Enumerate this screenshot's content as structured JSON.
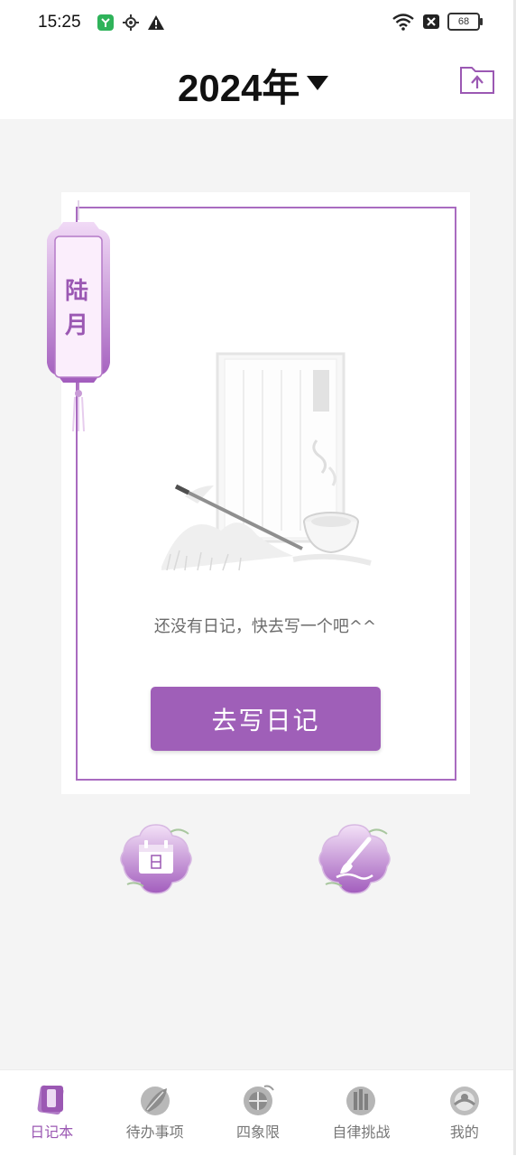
{
  "status_bar": {
    "time": "15:25",
    "battery": "68",
    "icons": [
      "app-notification-icon",
      "location-icon",
      "warning-icon",
      "wifi-icon",
      "no-sim-icon",
      "battery-icon"
    ]
  },
  "header": {
    "year_label": "2024年",
    "upload_icon": "cloud-upload-icon"
  },
  "diary_card": {
    "month_label": "陆\n月",
    "empty_message": "还没有日记，快去写一个吧^^",
    "write_button": "去写日记"
  },
  "quick_actions": [
    {
      "icon": "calendar-icon"
    },
    {
      "icon": "brush-icon"
    }
  ],
  "tabbar": {
    "active": 0,
    "tabs": [
      {
        "label": "日记本",
        "icon": "diary-book-icon"
      },
      {
        "label": "待办事项",
        "icon": "todo-leaf-icon"
      },
      {
        "label": "四象限",
        "icon": "quadrant-icon"
      },
      {
        "label": "自律挑战",
        "icon": "challenge-icon"
      },
      {
        "label": "我的",
        "icon": "profile-icon"
      }
    ]
  },
  "colors": {
    "accent": "#9f5fb8",
    "frame": "#a96bc0",
    "background": "#f4f4f4"
  }
}
